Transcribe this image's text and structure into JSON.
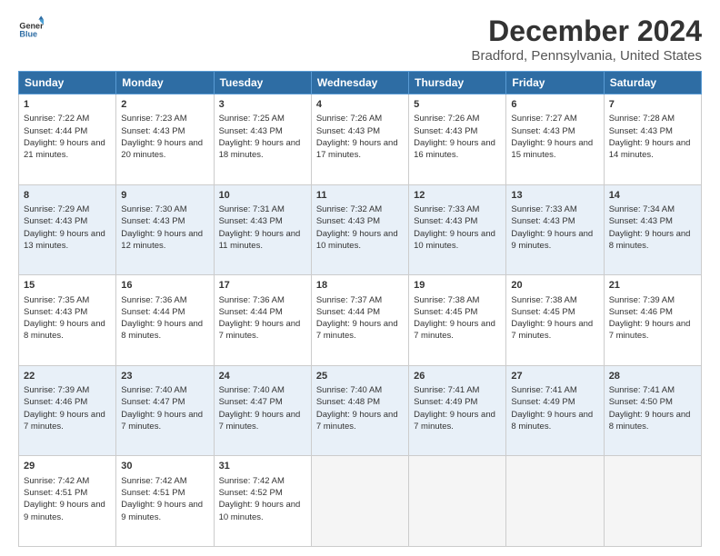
{
  "header": {
    "logo_line1": "General",
    "logo_line2": "Blue",
    "title": "December 2024",
    "subtitle": "Bradford, Pennsylvania, United States"
  },
  "columns": [
    "Sunday",
    "Monday",
    "Tuesday",
    "Wednesday",
    "Thursday",
    "Friday",
    "Saturday"
  ],
  "weeks": [
    [
      {
        "day": "1",
        "sunrise": "7:22 AM",
        "sunset": "4:44 PM",
        "daylight": "9 hours and 21 minutes."
      },
      {
        "day": "2",
        "sunrise": "7:23 AM",
        "sunset": "4:43 PM",
        "daylight": "9 hours and 20 minutes."
      },
      {
        "day": "3",
        "sunrise": "7:25 AM",
        "sunset": "4:43 PM",
        "daylight": "9 hours and 18 minutes."
      },
      {
        "day": "4",
        "sunrise": "7:26 AM",
        "sunset": "4:43 PM",
        "daylight": "9 hours and 17 minutes."
      },
      {
        "day": "5",
        "sunrise": "7:26 AM",
        "sunset": "4:43 PM",
        "daylight": "9 hours and 16 minutes."
      },
      {
        "day": "6",
        "sunrise": "7:27 AM",
        "sunset": "4:43 PM",
        "daylight": "9 hours and 15 minutes."
      },
      {
        "day": "7",
        "sunrise": "7:28 AM",
        "sunset": "4:43 PM",
        "daylight": "9 hours and 14 minutes."
      }
    ],
    [
      {
        "day": "8",
        "sunrise": "7:29 AM",
        "sunset": "4:43 PM",
        "daylight": "9 hours and 13 minutes."
      },
      {
        "day": "9",
        "sunrise": "7:30 AM",
        "sunset": "4:43 PM",
        "daylight": "9 hours and 12 minutes."
      },
      {
        "day": "10",
        "sunrise": "7:31 AM",
        "sunset": "4:43 PM",
        "daylight": "9 hours and 11 minutes."
      },
      {
        "day": "11",
        "sunrise": "7:32 AM",
        "sunset": "4:43 PM",
        "daylight": "9 hours and 10 minutes."
      },
      {
        "day": "12",
        "sunrise": "7:33 AM",
        "sunset": "4:43 PM",
        "daylight": "9 hours and 10 minutes."
      },
      {
        "day": "13",
        "sunrise": "7:33 AM",
        "sunset": "4:43 PM",
        "daylight": "9 hours and 9 minutes."
      },
      {
        "day": "14",
        "sunrise": "7:34 AM",
        "sunset": "4:43 PM",
        "daylight": "9 hours and 8 minutes."
      }
    ],
    [
      {
        "day": "15",
        "sunrise": "7:35 AM",
        "sunset": "4:43 PM",
        "daylight": "9 hours and 8 minutes."
      },
      {
        "day": "16",
        "sunrise": "7:36 AM",
        "sunset": "4:44 PM",
        "daylight": "9 hours and 8 minutes."
      },
      {
        "day": "17",
        "sunrise": "7:36 AM",
        "sunset": "4:44 PM",
        "daylight": "9 hours and 7 minutes."
      },
      {
        "day": "18",
        "sunrise": "7:37 AM",
        "sunset": "4:44 PM",
        "daylight": "9 hours and 7 minutes."
      },
      {
        "day": "19",
        "sunrise": "7:38 AM",
        "sunset": "4:45 PM",
        "daylight": "9 hours and 7 minutes."
      },
      {
        "day": "20",
        "sunrise": "7:38 AM",
        "sunset": "4:45 PM",
        "daylight": "9 hours and 7 minutes."
      },
      {
        "day": "21",
        "sunrise": "7:39 AM",
        "sunset": "4:46 PM",
        "daylight": "9 hours and 7 minutes."
      }
    ],
    [
      {
        "day": "22",
        "sunrise": "7:39 AM",
        "sunset": "4:46 PM",
        "daylight": "9 hours and 7 minutes."
      },
      {
        "day": "23",
        "sunrise": "7:40 AM",
        "sunset": "4:47 PM",
        "daylight": "9 hours and 7 minutes."
      },
      {
        "day": "24",
        "sunrise": "7:40 AM",
        "sunset": "4:47 PM",
        "daylight": "9 hours and 7 minutes."
      },
      {
        "day": "25",
        "sunrise": "7:40 AM",
        "sunset": "4:48 PM",
        "daylight": "9 hours and 7 minutes."
      },
      {
        "day": "26",
        "sunrise": "7:41 AM",
        "sunset": "4:49 PM",
        "daylight": "9 hours and 7 minutes."
      },
      {
        "day": "27",
        "sunrise": "7:41 AM",
        "sunset": "4:49 PM",
        "daylight": "9 hours and 8 minutes."
      },
      {
        "day": "28",
        "sunrise": "7:41 AM",
        "sunset": "4:50 PM",
        "daylight": "9 hours and 8 minutes."
      }
    ],
    [
      {
        "day": "29",
        "sunrise": "7:42 AM",
        "sunset": "4:51 PM",
        "daylight": "9 hours and 9 minutes."
      },
      {
        "day": "30",
        "sunrise": "7:42 AM",
        "sunset": "4:51 PM",
        "daylight": "9 hours and 9 minutes."
      },
      {
        "day": "31",
        "sunrise": "7:42 AM",
        "sunset": "4:52 PM",
        "daylight": "9 hours and 10 minutes."
      },
      null,
      null,
      null,
      null
    ]
  ],
  "labels": {
    "sunrise": "Sunrise:",
    "sunset": "Sunset:",
    "daylight": "Daylight:"
  }
}
